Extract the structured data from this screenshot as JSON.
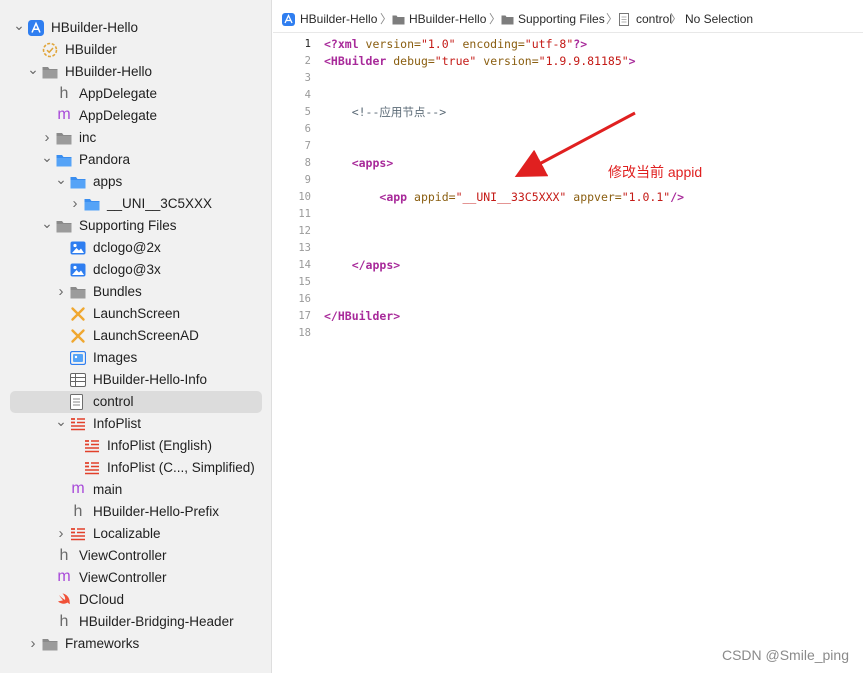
{
  "sidebar": {
    "items": [
      {
        "label": "HBuilder-Hello",
        "icon": "xcode-project-icon",
        "chevron": "down"
      },
      {
        "label": "HBuilder",
        "icon": "target-gear-icon",
        "chevron": ""
      },
      {
        "label": "HBuilder-Hello",
        "icon": "folder-icon",
        "chevron": "down"
      },
      {
        "label": "AppDelegate",
        "icon": "header-file-icon",
        "chevron": ""
      },
      {
        "label": "AppDelegate",
        "icon": "objc-file-icon",
        "chevron": ""
      },
      {
        "label": "inc",
        "icon": "folder-icon",
        "chevron": "right"
      },
      {
        "label": "Pandora",
        "icon": "blue-folder-icon",
        "chevron": "down"
      },
      {
        "label": "apps",
        "icon": "blue-folder-icon",
        "chevron": "down"
      },
      {
        "label": "__UNI__3C5XXX",
        "icon": "blue-folder-icon",
        "chevron": "right"
      },
      {
        "label": "Supporting Files",
        "icon": "folder-icon",
        "chevron": "down"
      },
      {
        "label": "dclogo@2x",
        "icon": "image-icon",
        "chevron": ""
      },
      {
        "label": "dclogo@3x",
        "icon": "image-icon",
        "chevron": ""
      },
      {
        "label": "Bundles",
        "icon": "folder-icon",
        "chevron": "right"
      },
      {
        "label": "LaunchScreen",
        "icon": "storyboard-icon",
        "chevron": ""
      },
      {
        "label": "LaunchScreenAD",
        "icon": "storyboard-icon",
        "chevron": ""
      },
      {
        "label": "Images",
        "icon": "asset-catalog-icon",
        "chevron": ""
      },
      {
        "label": "HBuilder-Hello-Info",
        "icon": "plist-table-icon",
        "chevron": ""
      },
      {
        "label": "control",
        "icon": "document-icon",
        "chevron": "",
        "selected": true
      },
      {
        "label": "InfoPlist",
        "icon": "strings-file-icon",
        "chevron": "down"
      },
      {
        "label": "InfoPlist (English)",
        "icon": "strings-file-icon",
        "chevron": ""
      },
      {
        "label": "InfoPlist (C..., Simplified)",
        "icon": "strings-file-icon",
        "chevron": ""
      },
      {
        "label": "main",
        "icon": "objc-file-icon",
        "chevron": ""
      },
      {
        "label": "HBuilder-Hello-Prefix",
        "icon": "header-file-icon",
        "chevron": ""
      },
      {
        "label": "Localizable",
        "icon": "strings-file-icon",
        "chevron": "right"
      },
      {
        "label": "ViewController",
        "icon": "header-file-icon",
        "chevron": ""
      },
      {
        "label": "ViewController",
        "icon": "objc-file-icon",
        "chevron": ""
      },
      {
        "label": "DCloud",
        "icon": "swift-file-icon",
        "chevron": ""
      },
      {
        "label": "HBuilder-Bridging-Header",
        "icon": "header-file-icon",
        "chevron": ""
      },
      {
        "label": "Frameworks",
        "icon": "folder-icon",
        "chevron": "right"
      }
    ]
  },
  "jumpbar": {
    "crumbs": [
      "HBuilder-Hello",
      "HBuilder-Hello",
      "Supporting Files",
      "control",
      "No Selection"
    ]
  },
  "editor": {
    "current_line": 1,
    "line_numbers": [
      "1",
      "2",
      "3",
      "4",
      "5",
      "6",
      "7",
      "8",
      "9",
      "10",
      "11",
      "12",
      "13",
      "14",
      "15",
      "16",
      "17",
      "18"
    ],
    "lines": [
      [
        {
          "t": "<?xml ",
          "c": "kw"
        },
        {
          "t": "version=",
          "c": "attr"
        },
        {
          "t": "\"1.0\" ",
          "c": "str"
        },
        {
          "t": "encoding=",
          "c": "attr"
        },
        {
          "t": "\"utf-8\"",
          "c": "str"
        },
        {
          "t": "?>",
          "c": "kw"
        }
      ],
      [
        {
          "t": "<HBuilder ",
          "c": "kw"
        },
        {
          "t": "debug=",
          "c": "attr"
        },
        {
          "t": "\"true\" ",
          "c": "str"
        },
        {
          "t": "version=",
          "c": "attr"
        },
        {
          "t": "\"1.9.9.81185\"",
          "c": "str"
        },
        {
          "t": ">",
          "c": "kw"
        }
      ],
      [],
      [],
      [
        {
          "t": "    <!--应用节点-->",
          "c": "cmt"
        }
      ],
      [],
      [],
      [
        {
          "t": "    ",
          "c": ""
        },
        {
          "t": "<apps>",
          "c": "kw"
        }
      ],
      [],
      [
        {
          "t": "        ",
          "c": ""
        },
        {
          "t": "<app ",
          "c": "kw"
        },
        {
          "t": "appid=",
          "c": "attr"
        },
        {
          "t": "\"__UNI__33C5XXX\" ",
          "c": "str"
        },
        {
          "t": "appver=",
          "c": "attr"
        },
        {
          "t": "\"1.0.1\"",
          "c": "str"
        },
        {
          "t": "/>",
          "c": "kw"
        }
      ],
      [],
      [],
      [],
      [
        {
          "t": "    ",
          "c": ""
        },
        {
          "t": "</apps>",
          "c": "kw"
        }
      ],
      [],
      [],
      [
        {
          "t": "</HBuilder>",
          "c": "kw"
        }
      ],
      []
    ]
  },
  "annotation": {
    "text": "修改当前 appid",
    "color": "#e02020"
  },
  "watermark": "CSDN @Smile_ping",
  "colors": {
    "accent_blue": "#3a8ef0",
    "selection": "#dcdcdc",
    "annotation_red": "#e02020"
  }
}
